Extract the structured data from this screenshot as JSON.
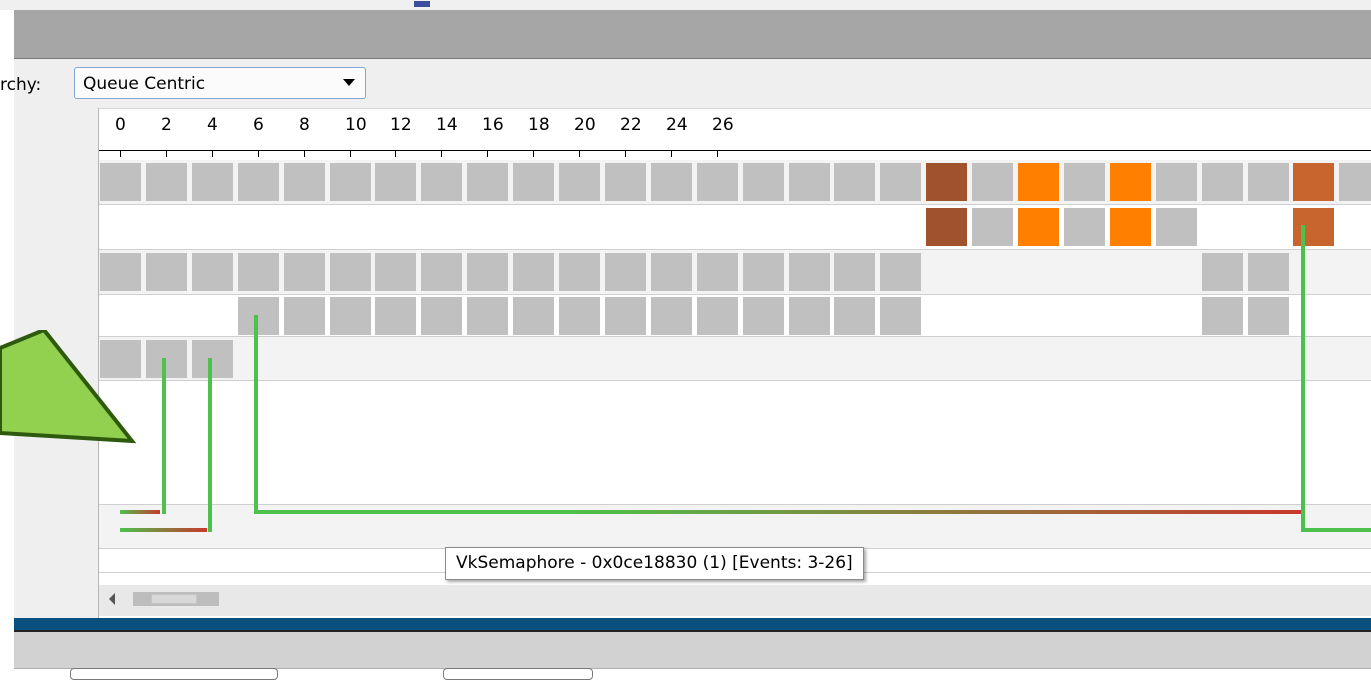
{
  "toolbar": {
    "hierarchy_label": "rchy:",
    "hierarchy_value": "Queue Centric"
  },
  "timeline": {
    "ticks": [
      {
        "label": "0"
      },
      {
        "label": "2"
      },
      {
        "label": "4"
      },
      {
        "label": "6"
      },
      {
        "label": "8"
      },
      {
        "label": "10"
      },
      {
        "label": "12"
      },
      {
        "label": "14"
      },
      {
        "label": "16"
      },
      {
        "label": "18"
      },
      {
        "label": "20"
      },
      {
        "label": "22"
      },
      {
        "label": "24"
      },
      {
        "label": "26"
      }
    ]
  },
  "tooltip": {
    "text": "VkSemaphore - 0x0ce18830 (1) [Events: 3-26]"
  },
  "colors": {
    "event_gray": "#c0c0c0",
    "event_dark_brown": "#a0522d",
    "event_orange": "#ff8000",
    "event_burnt_orange": "#c8642d",
    "semaphore_green": "#4ec04e",
    "semaphore_red": "#c8382d",
    "callout_green": "#92d050",
    "callout_border": "#2e5a0e"
  },
  "icons": {
    "dropdown": "chevron-down-icon",
    "scroll_left": "scroll-left-arrow-icon"
  }
}
